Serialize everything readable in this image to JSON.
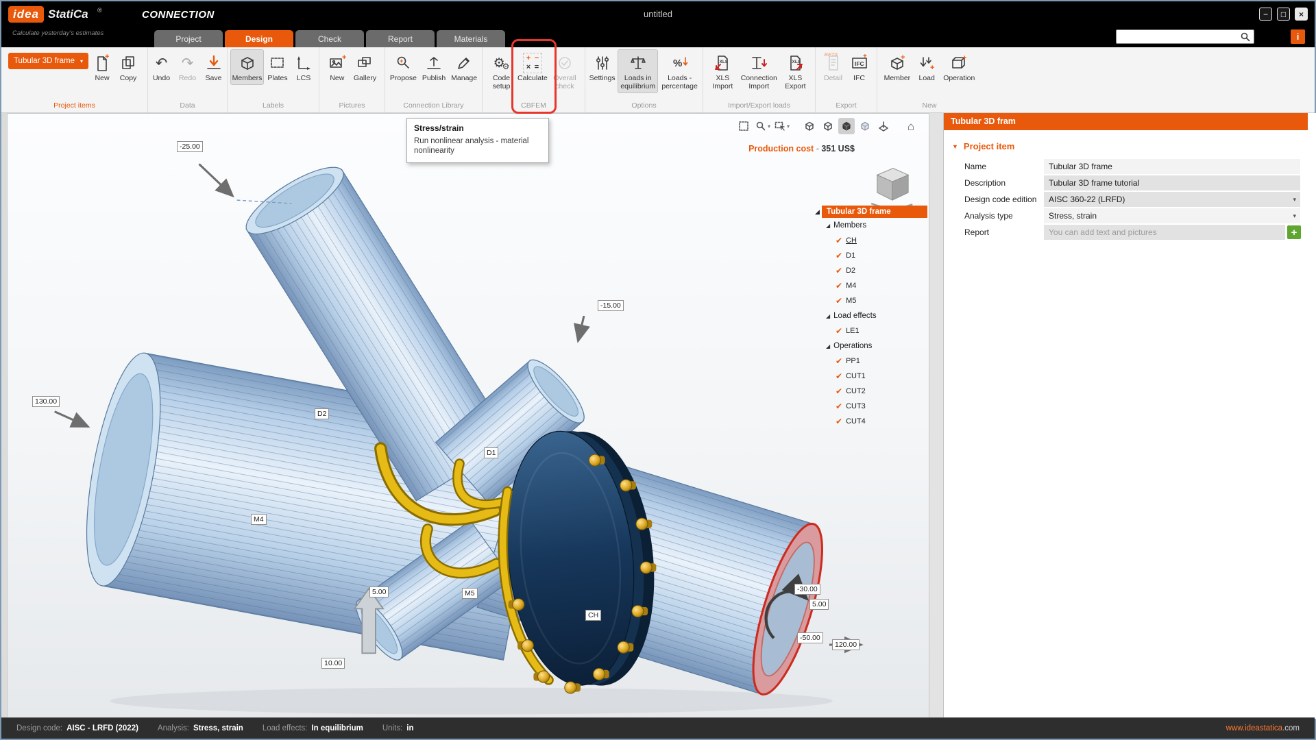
{
  "titlebar": {
    "logo_idea": "idea",
    "logo_statica": "StatiCa",
    "logo_reg": "®",
    "app_name": "CONNECTION",
    "tagline": "Calculate yesterday's estimates",
    "doc_title": "untitled"
  },
  "icons": {
    "undo": "↶",
    "redo": "↷",
    "gear": "⚙",
    "home": "⌂",
    "check": "✔",
    "chevron_down": "▾",
    "section_tri": "◢",
    "props_tri": "▼",
    "plus": "+",
    "minimize": "−",
    "maximize": "□",
    "close": "×"
  },
  "tabs": [
    {
      "label": "Project"
    },
    {
      "label": "Design"
    },
    {
      "label": "Check"
    },
    {
      "label": "Report"
    },
    {
      "label": "Materials"
    }
  ],
  "ribbon": {
    "groups": [
      {
        "label": "Project items",
        "items": [
          {
            "label": "Tubular 3D frame"
          },
          {
            "label": "New"
          },
          {
            "label": "Copy"
          }
        ]
      },
      {
        "label": "Data",
        "items": [
          {
            "label": "Undo"
          },
          {
            "label": "Redo"
          },
          {
            "label": "Save"
          }
        ]
      },
      {
        "label": "Labels",
        "items": [
          {
            "label": "Members"
          },
          {
            "label": "Plates"
          },
          {
            "label": "LCS"
          }
        ]
      },
      {
        "label": "Pictures",
        "items": [
          {
            "label": "New"
          },
          {
            "label": "Gallery"
          }
        ]
      },
      {
        "label": "Connection Library",
        "items": [
          {
            "label": "Propose"
          },
          {
            "label": "Publish"
          },
          {
            "label": "Manage"
          }
        ]
      },
      {
        "label": "CBFEM",
        "items": [
          {
            "label": "Code setup"
          },
          {
            "label": "Calculate"
          },
          {
            "label": "Overall check"
          }
        ]
      },
      {
        "label": "Options",
        "items": [
          {
            "label": "Settings"
          },
          {
            "label": "Loads in equilibrium"
          },
          {
            "label": "Loads - percentage"
          }
        ]
      },
      {
        "label": "Import/Export loads",
        "items": [
          {
            "label": "XLS Import"
          },
          {
            "label": "Connection Import"
          },
          {
            "label": "XLS Export"
          }
        ]
      },
      {
        "label": "Export",
        "items": [
          {
            "label": "Detail",
            "beta": "BETA"
          },
          {
            "label": "IFC"
          }
        ]
      },
      {
        "label": "New",
        "items": [
          {
            "label": "Member"
          },
          {
            "label": "Load"
          },
          {
            "label": "Operation"
          }
        ]
      }
    ]
  },
  "tooltip": {
    "title": "Stress/strain",
    "body": "Run nonlinear analysis - material nonlinearity"
  },
  "viewport": {
    "production_cost": {
      "label": "Production cost",
      "sep": " - ",
      "value": "351 US$"
    },
    "labels": [
      {
        "text": "-25.00"
      },
      {
        "text": "130.00"
      },
      {
        "text": "-15.00"
      },
      {
        "text": "D2"
      },
      {
        "text": "D1"
      },
      {
        "text": "M4"
      },
      {
        "text": "M5"
      },
      {
        "text": "CH"
      },
      {
        "text": "10.00"
      },
      {
        "text": "5.00"
      },
      {
        "text": "-30.00"
      },
      {
        "text": "5.00"
      },
      {
        "text": "-50.00"
      },
      {
        "text": "120.00"
      }
    ]
  },
  "tree": {
    "root": "Tubular 3D frame",
    "sections": [
      {
        "label": "Members",
        "items": [
          {
            "label": "CH"
          },
          {
            "label": "D1"
          },
          {
            "label": "D2"
          },
          {
            "label": "M4"
          },
          {
            "label": "M5"
          }
        ]
      },
      {
        "label": "Load effects",
        "items": [
          {
            "label": "LE1"
          }
        ]
      },
      {
        "label": "Operations",
        "items": [
          {
            "label": "PP1"
          },
          {
            "label": "CUT1"
          },
          {
            "label": "CUT2"
          },
          {
            "label": "CUT3"
          },
          {
            "label": "CUT4"
          }
        ]
      }
    ]
  },
  "properties": {
    "panel_title": "Tubular 3D fram",
    "section_title": "Project item",
    "rows": [
      {
        "label": "Name",
        "value": "Tubular 3D frame"
      },
      {
        "label": "Description",
        "value": "Tubular 3D frame tutorial"
      },
      {
        "label": "Design code edition",
        "value": "AISC 360-22 (LRFD)"
      },
      {
        "label": "Analysis type",
        "value": "Stress, strain"
      },
      {
        "label": "Report",
        "placeholder": "You can add text and pictures"
      }
    ]
  },
  "statusbar": {
    "items": [
      {
        "label": "Design code:",
        "value": "AISC - LRFD (2022)"
      },
      {
        "label": "Analysis:",
        "value": "Stress, strain"
      },
      {
        "label": "Load effects:",
        "value": "In equilibrium"
      },
      {
        "label": "Units:",
        "value": "in"
      }
    ],
    "website_main": "www.ideastatica",
    "website_tld": ".com"
  }
}
